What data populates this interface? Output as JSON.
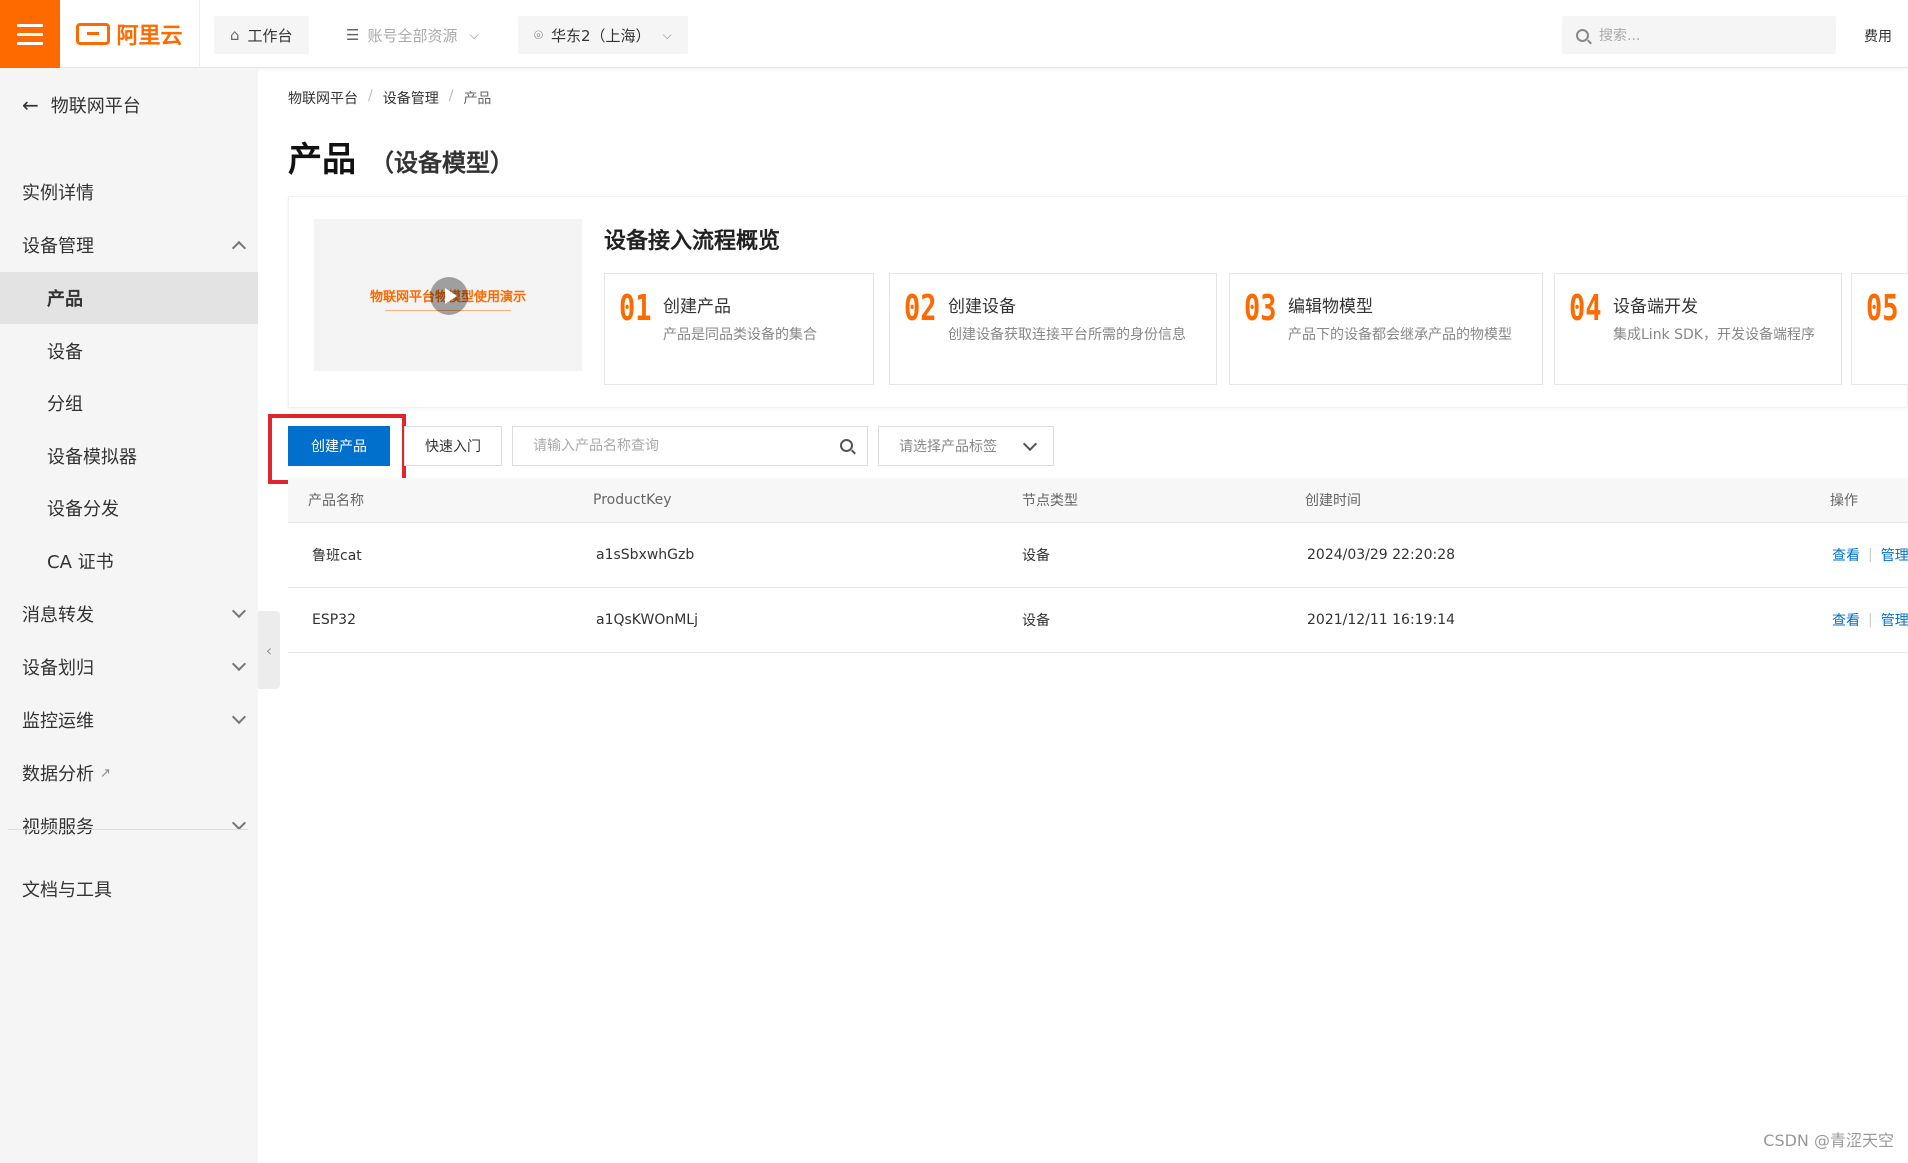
{
  "topbar": {
    "logo_text": "阿里云",
    "workbench": "工作台",
    "resources": "账号全部资源",
    "region": "华东2（上海）",
    "search_placeholder": "搜索...",
    "fee": "费用"
  },
  "sidebar": {
    "back_label": "物联网平台",
    "items": [
      {
        "label": "实例详情"
      },
      {
        "label": "设备管理"
      },
      {
        "label": "产品"
      },
      {
        "label": "设备"
      },
      {
        "label": "分组"
      },
      {
        "label": "设备模拟器"
      },
      {
        "label": "设备分发"
      },
      {
        "label": "CA 证书"
      },
      {
        "label": "消息转发"
      },
      {
        "label": "设备划归"
      },
      {
        "label": "监控运维"
      },
      {
        "label": "数据分析"
      },
      {
        "label": "视频服务"
      },
      {
        "label": "文档与工具"
      }
    ]
  },
  "breadcrumb": [
    "物联网平台",
    "设备管理",
    "产品"
  ],
  "page": {
    "title": "产品",
    "subtitle": "（设备模型）"
  },
  "overview": {
    "video_text": "物联网平台物模型使用演示",
    "title": "设备接入流程概览",
    "steps": [
      {
        "num": "01",
        "title": "创建产品",
        "desc": "产品是同品类设备的集合"
      },
      {
        "num": "02",
        "title": "创建设备",
        "desc": "创建设备获取连接平台所需的身份信息"
      },
      {
        "num": "03",
        "title": "编辑物模型",
        "desc": "产品下的设备都会继承产品的物模型"
      },
      {
        "num": "04",
        "title": "设备端开发",
        "desc": "集成Link SDK，开发设备端程序"
      },
      {
        "num": "05",
        "title": "",
        "desc": ""
      }
    ]
  },
  "toolbar": {
    "create_label": "创建产品",
    "quick_label": "快速入门",
    "search_placeholder": "请输入产品名称查询",
    "tag_placeholder": "请选择产品标签"
  },
  "table": {
    "headers": [
      "产品名称",
      "ProductKey",
      "节点类型",
      "创建时间",
      "操作"
    ],
    "rows": [
      {
        "name": "鲁班cat",
        "key": "a1sSbxwhGzb",
        "node": "设备",
        "time": "2024/03/29 22:20:28",
        "view": "查看",
        "manage": "管理"
      },
      {
        "name": "ESP32",
        "key": "a1QsKWOnMLj",
        "node": "设备",
        "time": "2021/12/11 16:19:14",
        "view": "查看",
        "manage": "管理"
      }
    ]
  },
  "watermark": "CSDN @青涩天空",
  "colors": {
    "accent": "#ff6a00",
    "primary": "#0070cc",
    "highlight": "#e0262c"
  }
}
